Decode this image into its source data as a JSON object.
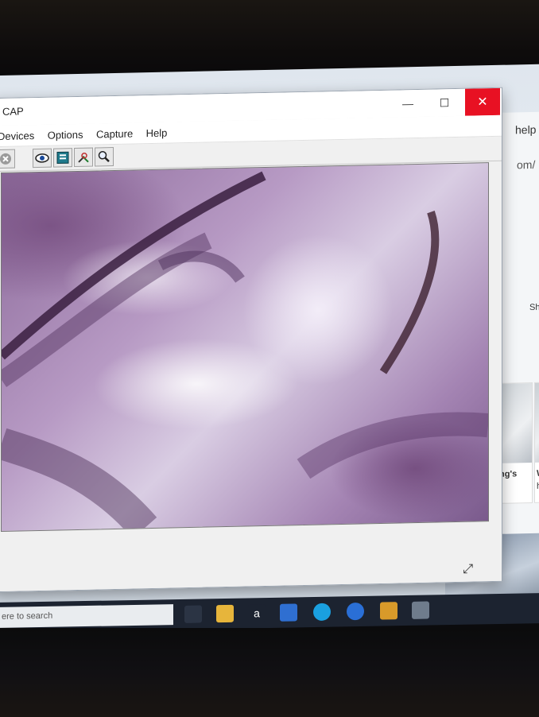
{
  "window": {
    "title": "CAP",
    "min_glyph": "—",
    "max_glyph": "☐",
    "close_glyph": "✕"
  },
  "menu": {
    "items": [
      "Devices",
      "Options",
      "Capture",
      "Help"
    ]
  },
  "toolbar": {
    "icons": [
      "stop-icon",
      "preview-eye-icon",
      "capture-frame-icon",
      "tools-icon",
      "zoom-icon"
    ]
  },
  "background_browser": {
    "text_help": "help",
    "text_url": "om/",
    "text_sh": "Sh",
    "card1_title": "ing's",
    "card1_sub": "e",
    "card2_title": "W",
    "card2_sub": "h"
  },
  "desktop": {
    "search_placeholder": "ere to search"
  },
  "colors": {
    "close_red": "#e81123",
    "taskbar": "#1c2330",
    "tissue_purple": "#8c6a9a"
  }
}
